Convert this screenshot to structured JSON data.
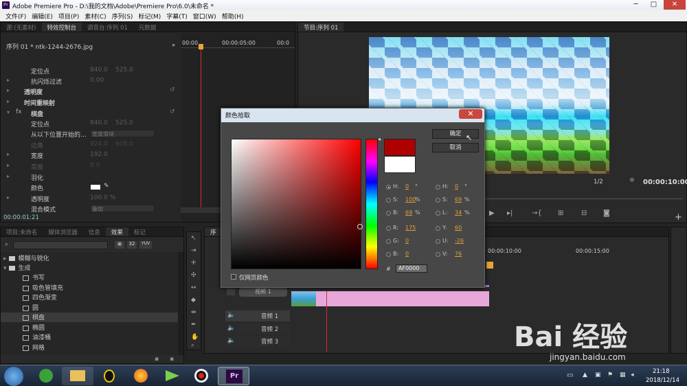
{
  "title_bar": {
    "app_icon": "Pr",
    "title": "Adobe Premiere Pro - D:\\我的文档\\Adobe\\Premiere Pro\\6.0\\未命名 *",
    "min": "─",
    "max": "□",
    "close": "✕"
  },
  "menu": [
    "文件(F)",
    "编辑(E)",
    "项目(P)",
    "素材(C)",
    "序列(S)",
    "标记(M)",
    "字幕(T)",
    "窗口(W)",
    "帮助(H)"
  ],
  "effect_controls": {
    "tabs": [
      "源:(无素材)",
      "特效控制台",
      "调音台:序列 01",
      "元数据"
    ],
    "clip_label": "序列 01 * ntk-1244-2676.jpg",
    "timeline_start": "00:00",
    "timeline_mid": "00:00:05:00",
    "timeline_end": "00:0",
    "rows": [
      {
        "label": "定位点",
        "v1": "840.0",
        "v2": "525.0"
      },
      {
        "label": "抗闪烁过滤",
        "v1": "0.00",
        "v2": ""
      },
      {
        "label": "透明度",
        "v1": "",
        "v2": ""
      },
      {
        "label": "时间重映射",
        "v1": "",
        "v2": ""
      },
      {
        "label": "棋盘",
        "v1": "",
        "v2": ""
      },
      {
        "label": "定位点",
        "v1": "840.0",
        "v2": "525.0"
      },
      {
        "label": "从以下位置开始的...",
        "dropdown": "宽度滑块"
      },
      {
        "label": "边角",
        "v1": "924.0",
        "v2": "609.0"
      },
      {
        "label": "宽度",
        "v1": "192.0",
        "v2": ""
      },
      {
        "label": "高度",
        "v1": "8.0",
        "v2": ""
      },
      {
        "label": "羽化",
        "v1": "",
        "v2": ""
      },
      {
        "label": "颜色",
        "v1": "",
        "v2": ""
      },
      {
        "label": "透明度",
        "v1": "100.0 %",
        "v2": ""
      },
      {
        "label": "混合模式",
        "dropdown": "叠加"
      }
    ],
    "timecode": "00:00:01:21"
  },
  "program_monitor": {
    "tab": "节目:序列 01",
    "zoom": "1/2",
    "timecode": "00:00:10:00",
    "ruler": "00:00"
  },
  "project_panel": {
    "tabs": [
      "项目:未命名",
      "媒体浏览器",
      "信息",
      "效果",
      "标记"
    ],
    "badges": [
      "32",
      "YUV"
    ],
    "items": [
      {
        "type": "folder",
        "label": "模糊与锐化"
      },
      {
        "type": "folder",
        "label": "生成"
      },
      {
        "type": "effect",
        "label": "书写"
      },
      {
        "type": "effect",
        "label": "吸色管填充"
      },
      {
        "type": "effect",
        "label": "四色渐变"
      },
      {
        "type": "effect",
        "label": "圆"
      },
      {
        "type": "effect",
        "label": "棋盘"
      },
      {
        "type": "effect",
        "label": "椭圆"
      },
      {
        "type": "effect",
        "label": "油漆桶"
      },
      {
        "type": "effect",
        "label": "网格"
      }
    ]
  },
  "timeline": {
    "tab": "序",
    "ruler": [
      "00:00:10:00",
      "00:00:15:00"
    ],
    "video_track": "视频 1",
    "audio_tracks": [
      "音频 1",
      "音频 2",
      "音频 3"
    ]
  },
  "color_dialog": {
    "title": "颜色拾取",
    "close": "✕",
    "ok": "确定",
    "cancel": "取消",
    "web_only": "仅网页颜色",
    "hex_label": "#",
    "hex": "AF0000",
    "left_fields": [
      {
        "key": "H:",
        "value": "0",
        "unit": "°",
        "selected": true
      },
      {
        "key": "S:",
        "value": "100",
        "unit": "%",
        "selected": false
      },
      {
        "key": "B:",
        "value": "69",
        "unit": "%",
        "selected": false
      },
      {
        "key": "R:",
        "value": "175",
        "unit": "",
        "selected": false
      },
      {
        "key": "G:",
        "value": "0",
        "unit": "",
        "selected": false
      },
      {
        "key": "B:",
        "value": "0",
        "unit": "",
        "selected": false
      }
    ],
    "right_fields": [
      {
        "key": "H:",
        "value": "0",
        "unit": "°"
      },
      {
        "key": "S:",
        "value": "69",
        "unit": "%"
      },
      {
        "key": "L:",
        "value": "34",
        "unit": "%"
      },
      {
        "key": "Y:",
        "value": "60",
        "unit": ""
      },
      {
        "key": "U:",
        "value": "-26",
        "unit": ""
      },
      {
        "key": "V:",
        "value": "76",
        "unit": ""
      }
    ],
    "new_color": "#af0000",
    "old_color": "#ffffff"
  },
  "watermark": {
    "text": "Bai 经验",
    "sub": "jingyan.baidu.com"
  },
  "taskbar": {
    "time": "21:18",
    "date": "2018/12/14",
    "active_app": "Pr"
  },
  "colors": {
    "playhead": "#d82d2d",
    "clip_pink": "#e7a8d9",
    "accent": "#e0a030"
  }
}
